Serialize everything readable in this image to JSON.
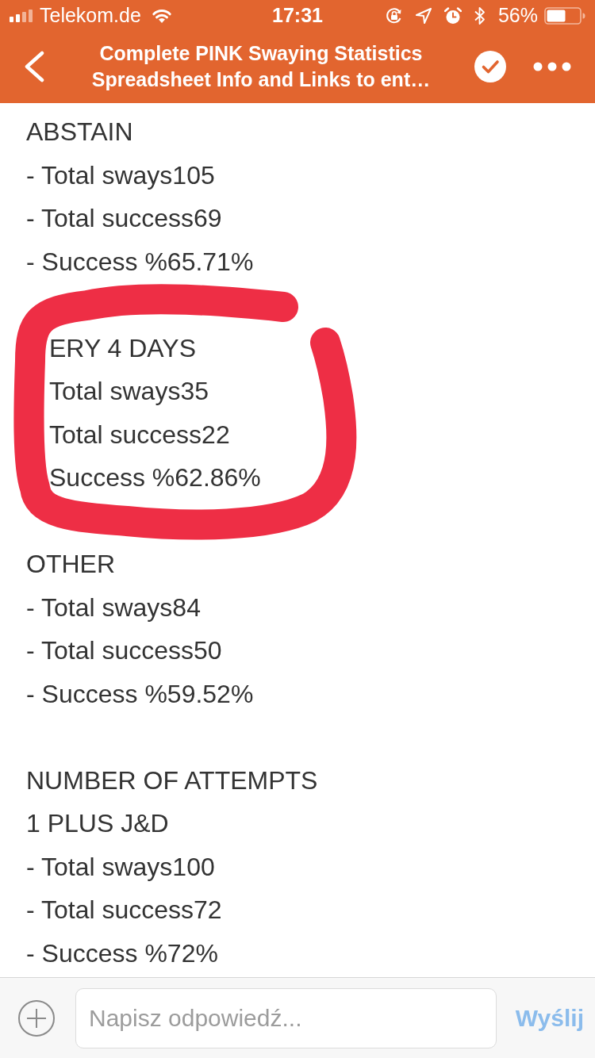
{
  "status_bar": {
    "carrier": "Telekom.de",
    "time": "17:31",
    "battery": "56%"
  },
  "nav_bar": {
    "title": "Complete PINK Swaying Statistics\nSpreadsheet Info and Links to ent…"
  },
  "content": {
    "blocks": [
      {
        "circled": false,
        "lines": [
          "ABSTAIN",
          "- Total sways105",
          "- Total success69",
          "- Success %65.71%"
        ]
      },
      {
        "circled": true,
        "lines": [
          "ERY 4 DAYS",
          "Total sways35",
          "Total success22",
          "Success %62.86%"
        ]
      },
      {
        "circled": false,
        "lines": [
          "OTHER",
          "- Total sways84",
          "- Total success50",
          "- Success %59.52%"
        ]
      },
      {
        "circled": false,
        "lines": [
          "NUMBER OF ATTEMPTS",
          "1 PLUS J&D",
          "- Total sways100",
          "- Total success72",
          "- Success %72%"
        ]
      }
    ]
  },
  "composer": {
    "placeholder": "Napisz odpowiedź...",
    "send_button": {
      "label": "Wyślij",
      "disabled": true
    }
  }
}
